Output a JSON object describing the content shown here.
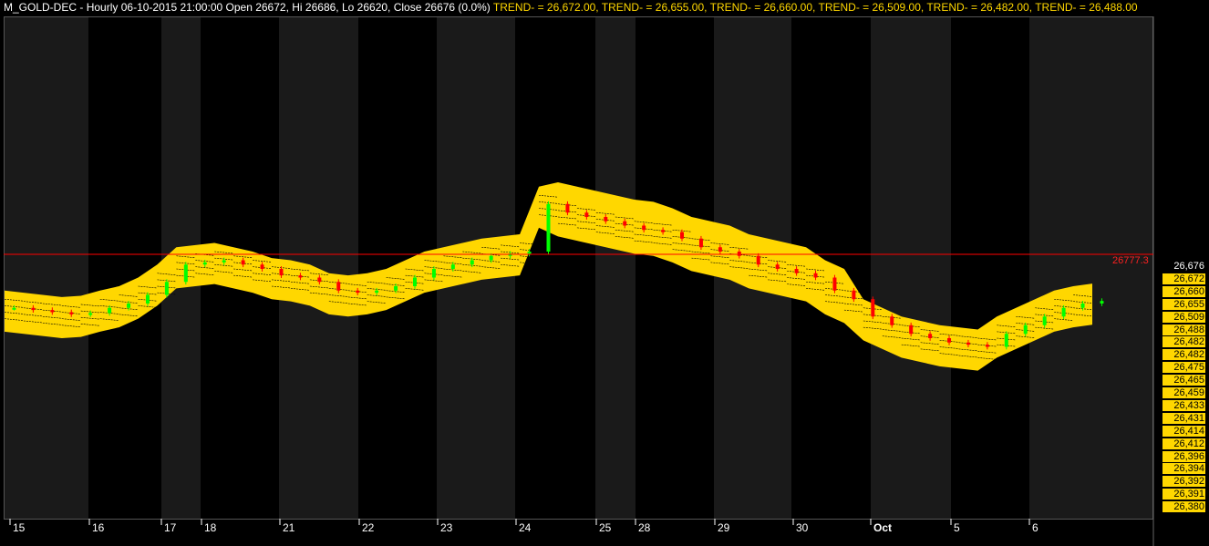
{
  "header": {
    "symbol": "M_GOLD-DEC",
    "interval": "Hourly",
    "datetime": "06-10-2015 21:00:00",
    "open_label": "Open 26672,",
    "hi_label": "Hi 26686,",
    "lo_label": "Lo 26620,",
    "close_label": "Close 26676 (0.0%)",
    "trends": [
      "TREND- = 26,672.00,",
      "TREND- = 26,655.00,",
      "TREND- = 26,660.00,",
      "TREND- = 26,509.00,",
      "TREND- = 26,482.00,",
      "TREND- = 26,488.00"
    ]
  },
  "colors": {
    "background": "#000000",
    "band_alt": "#1a1a1a",
    "trend_fill": "#ffd700",
    "up_candle": "#00ff00",
    "down_candle": "#ff0000",
    "hline": "#ff0000",
    "text": "#ffffff"
  },
  "chart_data": {
    "type": "candlestick",
    "title": "",
    "xlabel": "",
    "ylabel": "",
    "reference_line": {
      "value": 26777.3,
      "label": "26777.3"
    },
    "price_axis_labels": [
      "26,676",
      "26,672",
      "26,660",
      "26,655",
      "26,509",
      "26,488",
      "26,482",
      "26,482",
      "26,475",
      "26,465",
      "26,459",
      "26,433",
      "26,431",
      "26,414",
      "26,412",
      "26,396",
      "26,394",
      "26,392",
      "26,391",
      "26,380"
    ],
    "date_labels": [
      "15",
      "16",
      "17",
      "18",
      "21",
      "22",
      "23",
      "24",
      "25",
      "28",
      "29",
      "30",
      "Oct",
      "5",
      "6"
    ],
    "session_close_path": [
      26660,
      26655,
      26650,
      26645,
      26648,
      26660,
      26670,
      26690,
      26720,
      26760,
      26765,
      26770,
      26760,
      26750,
      26735,
      26730,
      26720,
      26700,
      26695,
      26700,
      26710,
      26730,
      26750,
      26760,
      26770,
      26780,
      26785,
      26790,
      26900,
      26880,
      26870,
      26860,
      26850,
      26840,
      26835,
      26820,
      26800,
      26790,
      26780,
      26760,
      26750,
      26740,
      26730,
      26700,
      26680,
      26640,
      26620,
      26600,
      26590,
      26580,
      26575,
      26570,
      26600,
      26620,
      26640,
      26660,
      26670,
      26676
    ],
    "trend_band": {
      "upper_max": 26920,
      "lower_min": 26570
    },
    "grid": false,
    "legend": "none"
  }
}
